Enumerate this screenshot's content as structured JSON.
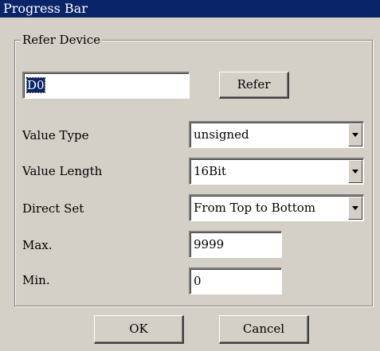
{
  "window": {
    "title": "Progress Bar"
  },
  "refer_device": {
    "group_label": "Refer Device",
    "device_value": "D0",
    "refer_button": "Refer"
  },
  "fields": {
    "value_type": {
      "label": "Value Type",
      "value": "unsigned"
    },
    "value_length": {
      "label": "Value Length",
      "value": "16Bit"
    },
    "direct_set": {
      "label": "Direct Set",
      "value": "From Top to Bottom"
    },
    "max": {
      "label": "Max.",
      "value": "9999"
    },
    "min": {
      "label": "Min.",
      "value": "0"
    }
  },
  "buttons": {
    "ok": "OK",
    "cancel": "Cancel"
  },
  "icons": {
    "dropdown": "chevron-down-icon"
  },
  "colors": {
    "titlebar": "#0a246a",
    "face": "#d4d0c8",
    "field": "#ffffff"
  }
}
